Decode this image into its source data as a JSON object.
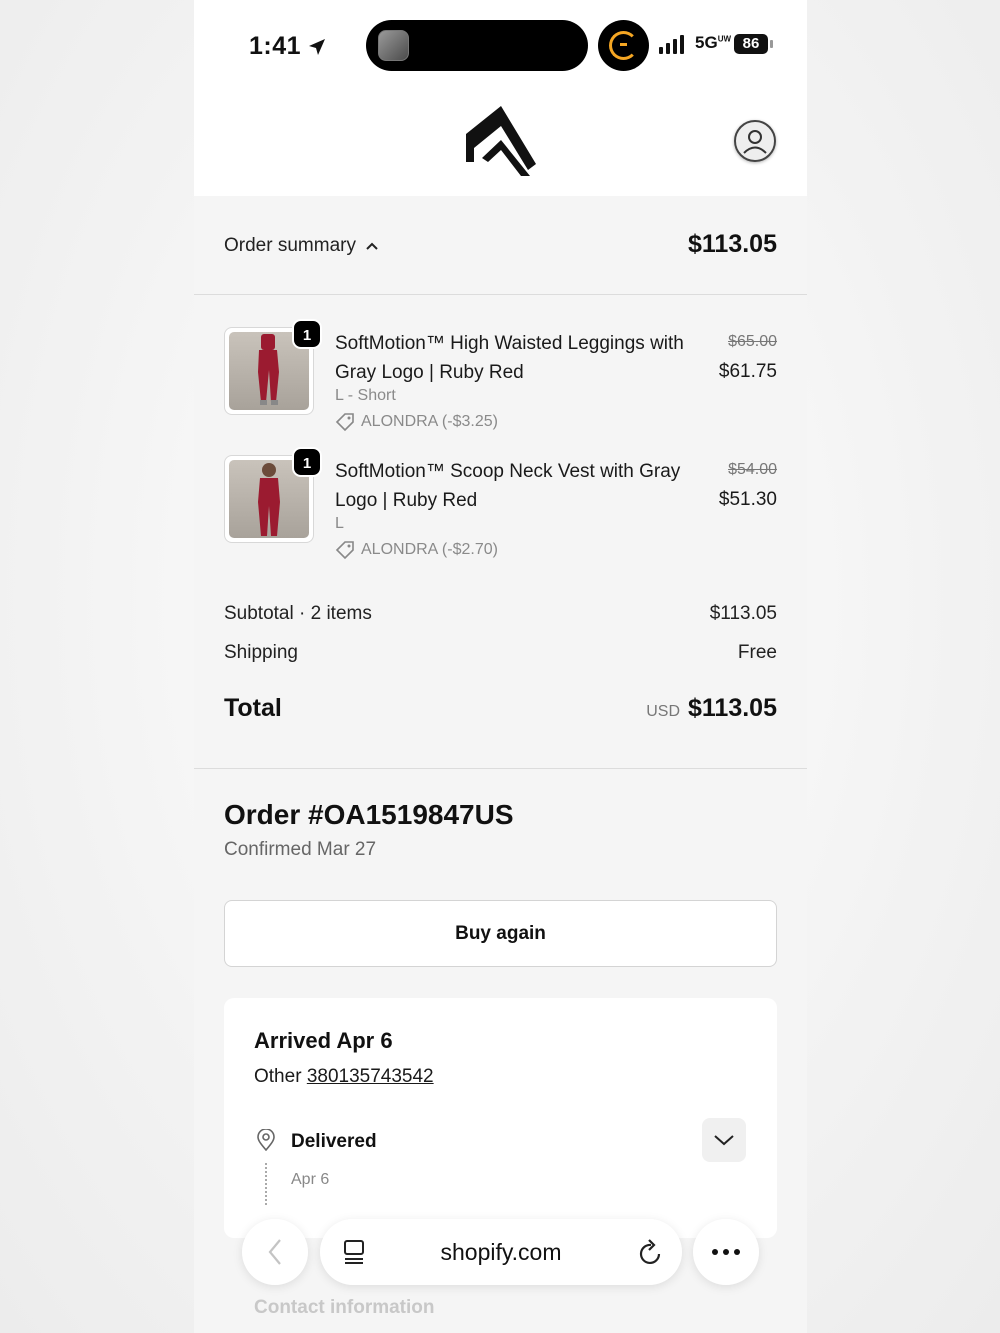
{
  "status_bar": {
    "time": "1:41",
    "network": "5G",
    "network_suffix": "UW",
    "battery": "86"
  },
  "summary": {
    "label": "Order summary",
    "total": "$113.05",
    "items": [
      {
        "quantity": "1",
        "title": "SoftMotion™ High Waisted Leggings with Gray Logo | Ruby Red",
        "variant": "L - Short",
        "discount": "ALONDRA (-$3.25)",
        "original_price": "$65.00",
        "price": "$61.75"
      },
      {
        "quantity": "1",
        "title": "SoftMotion™ Scoop Neck Vest with Gray Logo | Ruby Red",
        "variant": "L",
        "discount": "ALONDRA (-$2.70)",
        "original_price": "$54.00",
        "price": "$51.30"
      }
    ],
    "subtotal_label": "Subtotal · 2 items",
    "subtotal_value": "$113.05",
    "shipping_label": "Shipping",
    "shipping_value": "Free",
    "total_label": "Total",
    "currency": "USD",
    "total_value": "$113.05"
  },
  "order": {
    "title": "Order #OA1519847US",
    "confirmed": "Confirmed Mar 27",
    "buy_again": "Buy again",
    "shipment": {
      "title": "Arrived Apr 6",
      "carrier": "Other",
      "tracking_number": "380135743542",
      "status": "Delivered",
      "status_date": "Apr 6"
    },
    "next_section": "Contact information"
  },
  "browser": {
    "url": "shopify.com"
  },
  "colors": {
    "product": "#9b1b30",
    "background": "#f5f5f5",
    "accent_status": "#f5a623"
  }
}
